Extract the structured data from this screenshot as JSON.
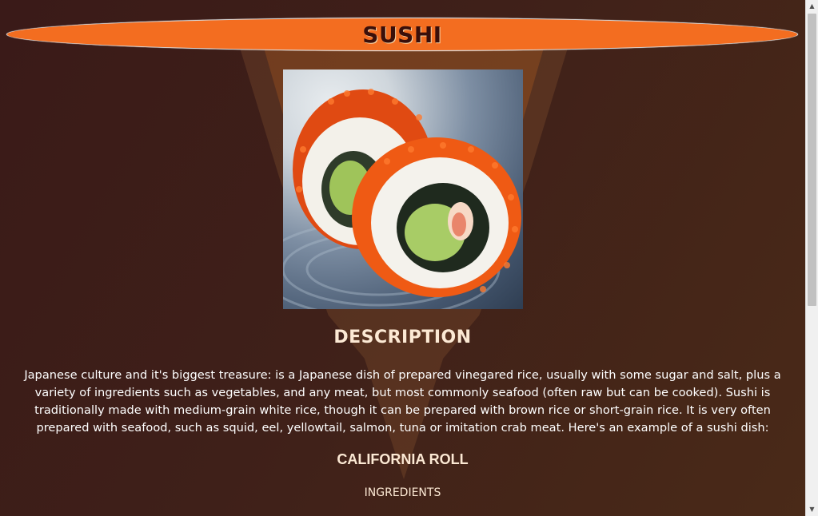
{
  "header": {
    "title": "SUSHI"
  },
  "image": {
    "subject": "california-roll-photo"
  },
  "description": {
    "heading": "DESCRIPTION",
    "text": "Japanese culture and it's biggest treasure: is a Japanese dish of prepared vinegared rice, usually with some sugar and salt, plus a variety of ingredients such as vegetables, and any meat, but most commonly seafood (often raw but can be cooked). Sushi is traditionally made with medium-grain white rice, though it can be prepared with brown rice or short-grain rice. It is very often prepared with seafood, such as squid, eel, yellowtail, salmon, tuna or imitation crab meat. Here's an example of a sushi dish:"
  },
  "dish": {
    "name": "CALIFORNIA ROLL",
    "ingredients_heading": "INGREDIENTS"
  },
  "scrollbar": {
    "up_glyph": "▲",
    "down_glyph": "▼"
  },
  "colors": {
    "banner": "#f36d20",
    "title_text": "#3a0f0a",
    "background": "#3f2019",
    "heading_text": "#fce9d4"
  }
}
